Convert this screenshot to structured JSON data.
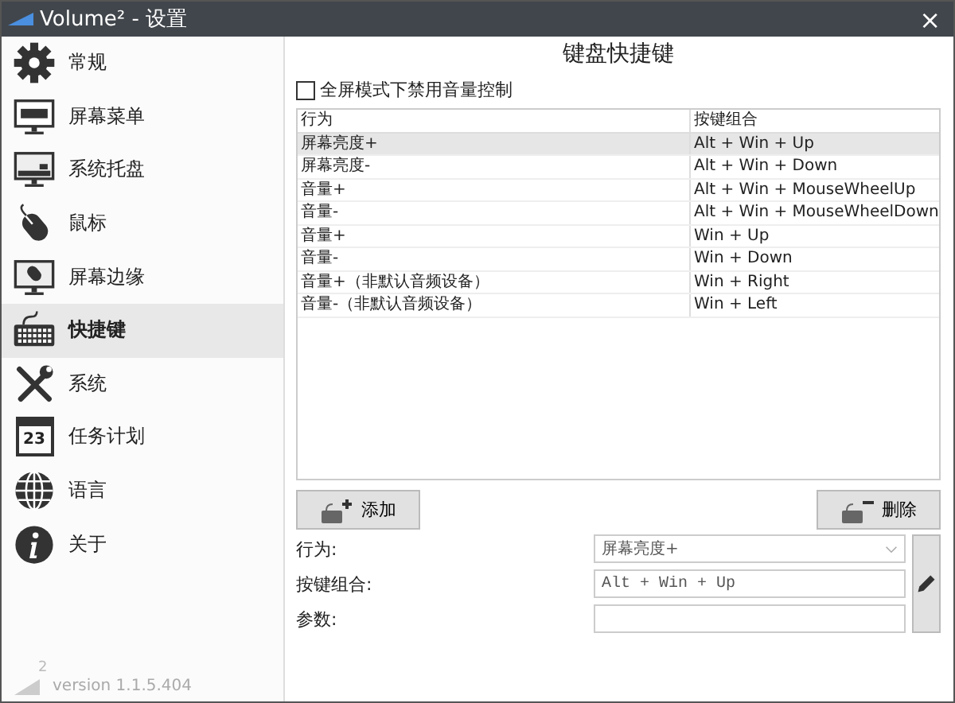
{
  "window": {
    "title": "Volume² - 设置",
    "close": "×"
  },
  "sidebar": {
    "items": [
      {
        "kind": "gear",
        "label": "常规",
        "selected": false
      },
      {
        "kind": "menu",
        "label": "屏幕菜单",
        "selected": false
      },
      {
        "kind": "tray",
        "label": "系统托盘",
        "selected": false
      },
      {
        "kind": "mouse",
        "label": "鼠标",
        "selected": false
      },
      {
        "kind": "edge",
        "label": "屏幕边缘",
        "selected": false
      },
      {
        "kind": "keyboard",
        "label": "快捷键",
        "selected": true
      },
      {
        "kind": "tools",
        "label": "系统",
        "selected": false
      },
      {
        "kind": "calendar",
        "label": "任务计划",
        "selected": false,
        "badge": "23"
      },
      {
        "kind": "globe",
        "label": "语言",
        "selected": false
      },
      {
        "kind": "info",
        "label": "关于",
        "selected": false
      }
    ],
    "logo_mark": "2",
    "version": "version 1.1.5.404"
  },
  "main": {
    "heading": "键盘快捷键",
    "fullscreen_option": {
      "label": "全屏模式下禁用音量控制",
      "checked": false
    },
    "table": {
      "columns": [
        "行为",
        "按键组合"
      ],
      "rows": [
        {
          "action": "屏幕亮度+",
          "keys": "Alt + Win + Up",
          "selected": true
        },
        {
          "action": "屏幕亮度-",
          "keys": "Alt + Win + Down",
          "selected": false
        },
        {
          "action": "音量+",
          "keys": "Alt + Win + MouseWheelUp",
          "selected": false
        },
        {
          "action": "音量-",
          "keys": "Alt + Win + MouseWheelDown",
          "selected": false
        },
        {
          "action": "音量+",
          "keys": "Win + Up",
          "selected": false
        },
        {
          "action": "音量-",
          "keys": "Win + Down",
          "selected": false
        },
        {
          "action": "音量+（非默认音频设备）",
          "keys": "Win + Right",
          "selected": false
        },
        {
          "action": "音量-（非默认音频设备）",
          "keys": "Win + Left",
          "selected": false
        }
      ]
    },
    "add_button": "添加",
    "delete_button": "删除",
    "form": {
      "action_label": "行为:",
      "action_value": "屏幕亮度+",
      "keys_label": "按键组合:",
      "keys_value": "Alt + Win + Up",
      "param_label": "参数:"
    }
  }
}
